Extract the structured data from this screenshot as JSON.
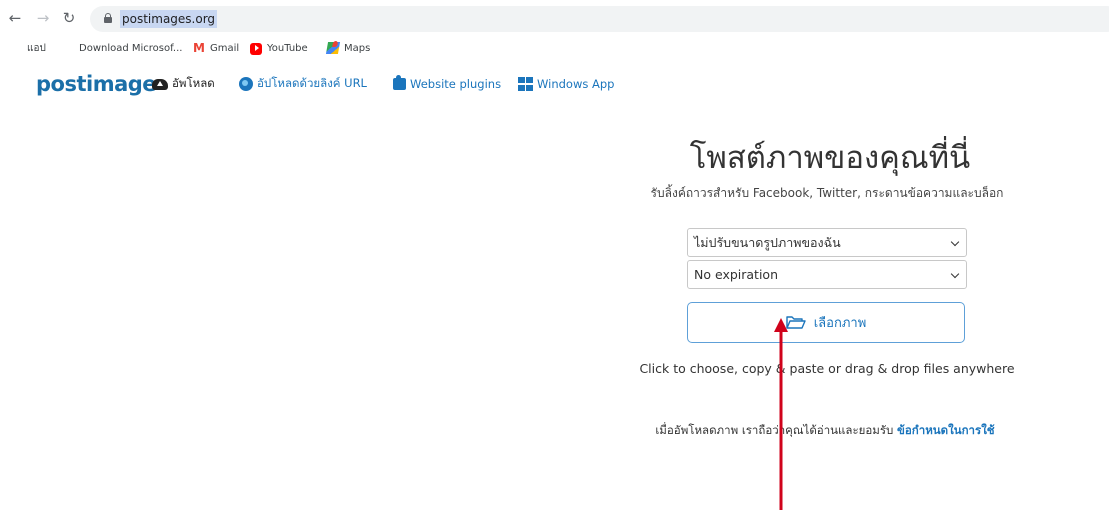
{
  "browser": {
    "url": "postimages.org",
    "bookmarks": [
      {
        "label": "แอป",
        "icon": "apps-grid-icon"
      },
      {
        "label": "Download Microsof...",
        "icon": "microsoft-icon"
      },
      {
        "label": "Gmail",
        "icon": "gmail-icon"
      },
      {
        "label": "YouTube",
        "icon": "youtube-icon"
      },
      {
        "label": "Maps",
        "icon": "maps-icon"
      }
    ]
  },
  "site": {
    "logo": "postimage",
    "nav": [
      {
        "label": "อัพโหลด",
        "icon": "cloud-upload-icon"
      },
      {
        "label": "อัปโหลดด้วยลิงค์ URL",
        "icon": "globe-icon"
      },
      {
        "label": "Website plugins",
        "icon": "puzzle-icon"
      },
      {
        "label": "Windows App",
        "icon": "windows-icon"
      }
    ]
  },
  "upload": {
    "heading": "โพสต์ภาพของคุณที่นี่",
    "subheading": "รับลิ้งค์ถาวรสำหรับ Facebook, Twitter, กระดานข้อความและบล็อก",
    "resize_select": "ไม่ปรับขนาดรูปภาพของฉัน",
    "expiration_select": "No expiration",
    "choose_button": "เลือกภาพ",
    "hint": "Click to choose, copy & paste or drag & drop files anywhere",
    "terms_text": "เมื่ออัพโหลดภาพ เราถือว่าคุณได้อ่านและยอมรับ",
    "terms_link": "ข้อกำหนดในการใช้"
  },
  "colors": {
    "brand": "#1b6fa8",
    "link": "#1b75bc",
    "annotation_arrow": "#d0021b"
  }
}
